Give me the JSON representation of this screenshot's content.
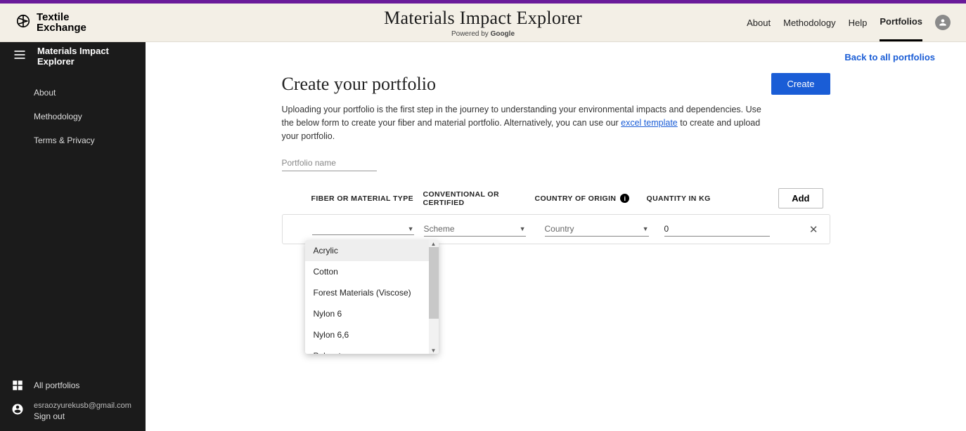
{
  "brand": {
    "name": "Textile\nExchange"
  },
  "header": {
    "title": "Materials Impact Explorer",
    "powered_prefix": "Powered by ",
    "powered_brand": "Google"
  },
  "nav": {
    "about": "About",
    "methodology": "Methodology",
    "help": "Help",
    "portfolios": "Portfolios"
  },
  "sidebar": {
    "title": "Materials Impact Explorer",
    "links": {
      "about": "About",
      "methodology": "Methodology",
      "terms": "Terms & Privacy"
    },
    "all_portfolios": "All portfolios",
    "user_email": "esraozyurekusb@gmail.com",
    "sign_out": "Sign out"
  },
  "main": {
    "back_link": "Back to all portfolios",
    "heading": "Create your portfolio",
    "create_btn": "Create",
    "desc_part1": "Uploading your portfolio is the first step in the journey to understanding your environmental impacts and dependencies. Use the below form to create your fiber and material portfolio. Alternatively, you can use our ",
    "desc_link": "excel template",
    "desc_part2": " to create and upload your portfolio.",
    "portfolio_name_placeholder": "Portfolio name",
    "columns": {
      "fiber": "FIBER OR MATERIAL TYPE",
      "cert": "CONVENTIONAL OR CERTIFIED",
      "origin": "COUNTRY OF ORIGIN",
      "qty": "QUANTITY IN KG"
    },
    "add_btn": "Add",
    "row": {
      "scheme_placeholder": "Scheme",
      "country_placeholder": "Country",
      "qty_value": "0"
    },
    "dropdown_options": [
      "Acrylic",
      "Cotton",
      "Forest Materials (Viscose)",
      "Nylon 6",
      "Nylon 6,6",
      "Polyester"
    ]
  }
}
